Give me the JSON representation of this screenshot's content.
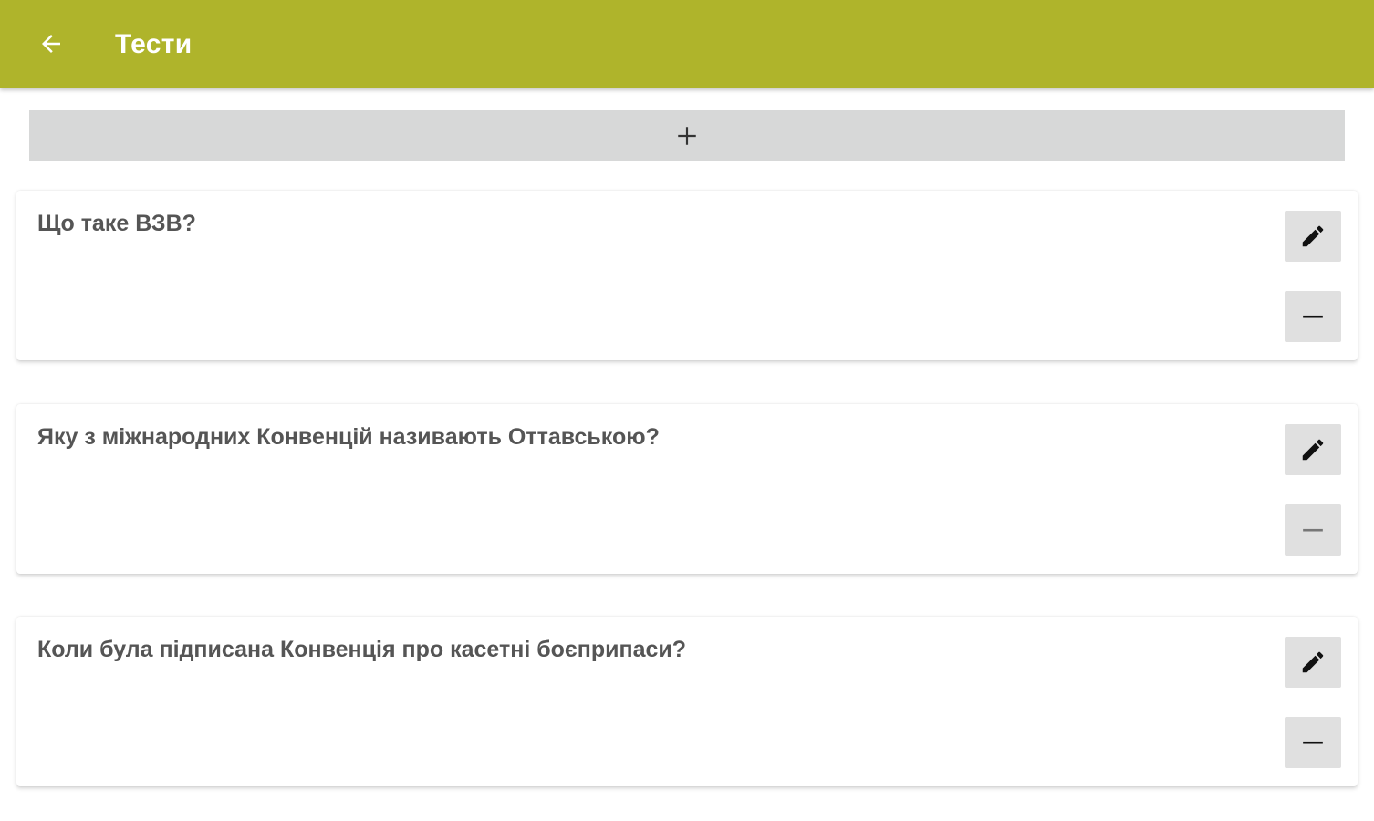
{
  "appbar": {
    "title": "Тести",
    "back_icon": "arrow-left-icon",
    "color": "#afb42b"
  },
  "add_button": {
    "icon": "plus-icon"
  },
  "questions": [
    {
      "text": "Що таке ВЗВ?"
    },
    {
      "text": "Яку з міжнародних Конвенцій називають Оттавською?"
    },
    {
      "text": "Коли була підписана Конвенція про касетні боєприпаси?"
    }
  ],
  "actions": {
    "edit_icon": "pencil-icon",
    "remove_icon": "minus-icon"
  }
}
